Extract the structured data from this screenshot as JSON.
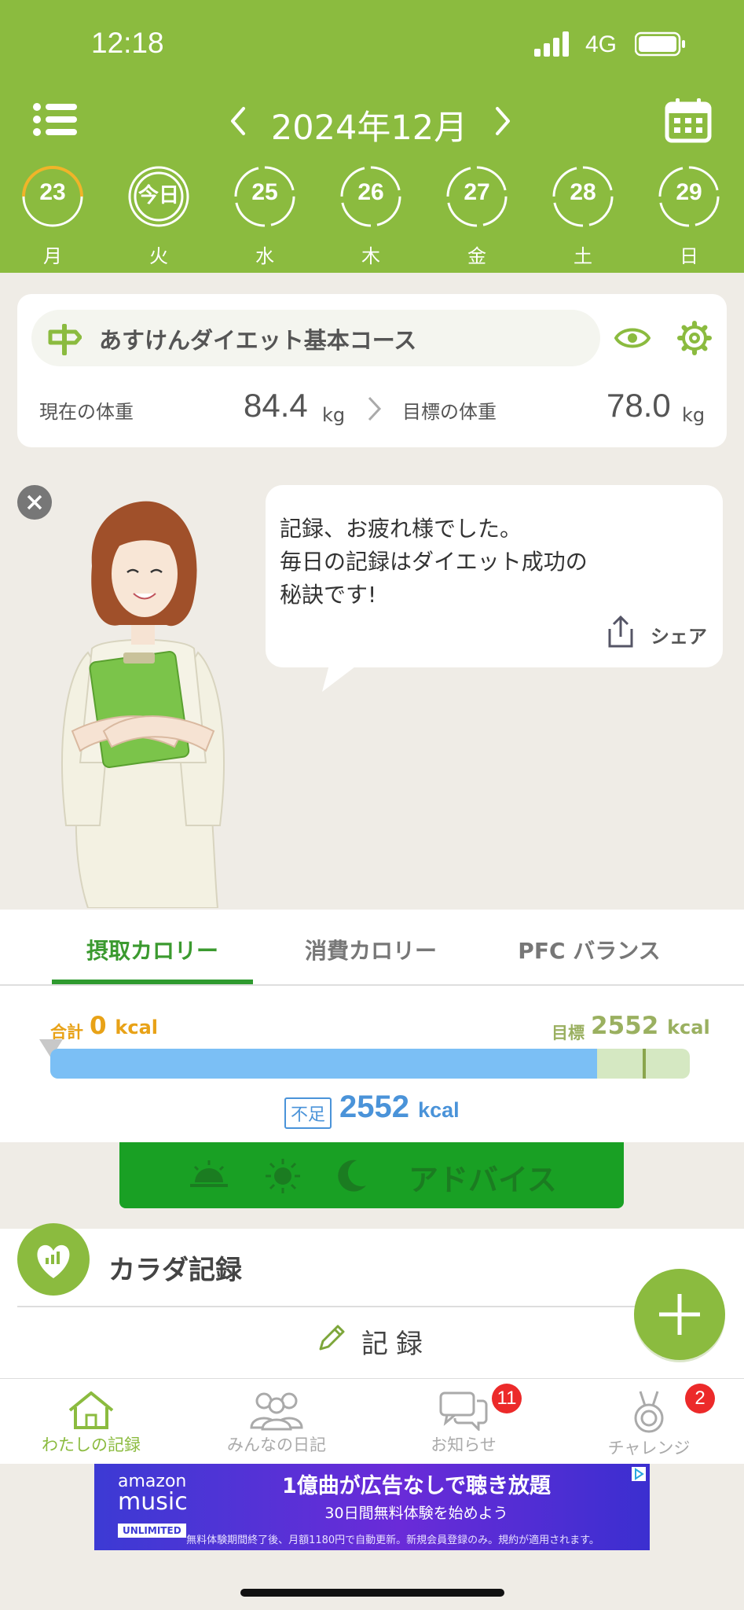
{
  "status": {
    "time": "12:18",
    "network": "4G"
  },
  "header": {
    "month": "2024年12月",
    "days": [
      {
        "num": "23",
        "weekday": "月"
      },
      {
        "num": "今日",
        "weekday": "火"
      },
      {
        "num": "25",
        "weekday": "水"
      },
      {
        "num": "26",
        "weekday": "木"
      },
      {
        "num": "27",
        "weekday": "金"
      },
      {
        "num": "28",
        "weekday": "土"
      },
      {
        "num": "29",
        "weekday": "日"
      }
    ]
  },
  "course": {
    "name": "あすけんダイエット基本コース",
    "current_label": "現在の体重",
    "current_value": "84.4",
    "target_label": "目標の体重",
    "target_value": "78.0",
    "unit": "kg"
  },
  "advisor": {
    "message_lines": [
      "記録、お疲れ様でした。",
      "毎日の記録はダイエット成功の",
      "秘訣です!"
    ],
    "share_label": "シェア"
  },
  "calorie": {
    "tabs": [
      "摂取カロリー",
      "消費カロリー",
      "PFC バランス"
    ],
    "total_label": "合計",
    "total_value": "0",
    "target_label": "目標",
    "target_value": "2552",
    "unit": "kcal",
    "lack_label": "不足",
    "lack_value": "2552",
    "fill_fraction": 0.855,
    "advice_label": "アドバイス"
  },
  "body_record": {
    "title": "カラダ記録",
    "record_label": "記録"
  },
  "bottom_nav": {
    "items": [
      {
        "label": "わたしの記録",
        "badge": ""
      },
      {
        "label": "みんなの日記",
        "badge": ""
      },
      {
        "label": "お知らせ",
        "badge": "11"
      },
      {
        "label": "チャレンジ",
        "badge": "2"
      }
    ]
  },
  "ad": {
    "brand_line1": "amazon",
    "brand_line2": "music",
    "brand_tag": "UNLIMITED",
    "headline": "1億曲が広告なしで聴き放題",
    "subline": "30日間無料体験を始めよう",
    "fine_print": "無料体験期間終了後、月額1180円で自動更新。新規会員登録のみ。規約が適用されます。"
  },
  "colors": {
    "brand_green": "#8bbb3f",
    "accent_green": "#19a024",
    "blue": "#4a93d9",
    "orange": "#e8a217",
    "badge_red": "#ec2a2a"
  }
}
